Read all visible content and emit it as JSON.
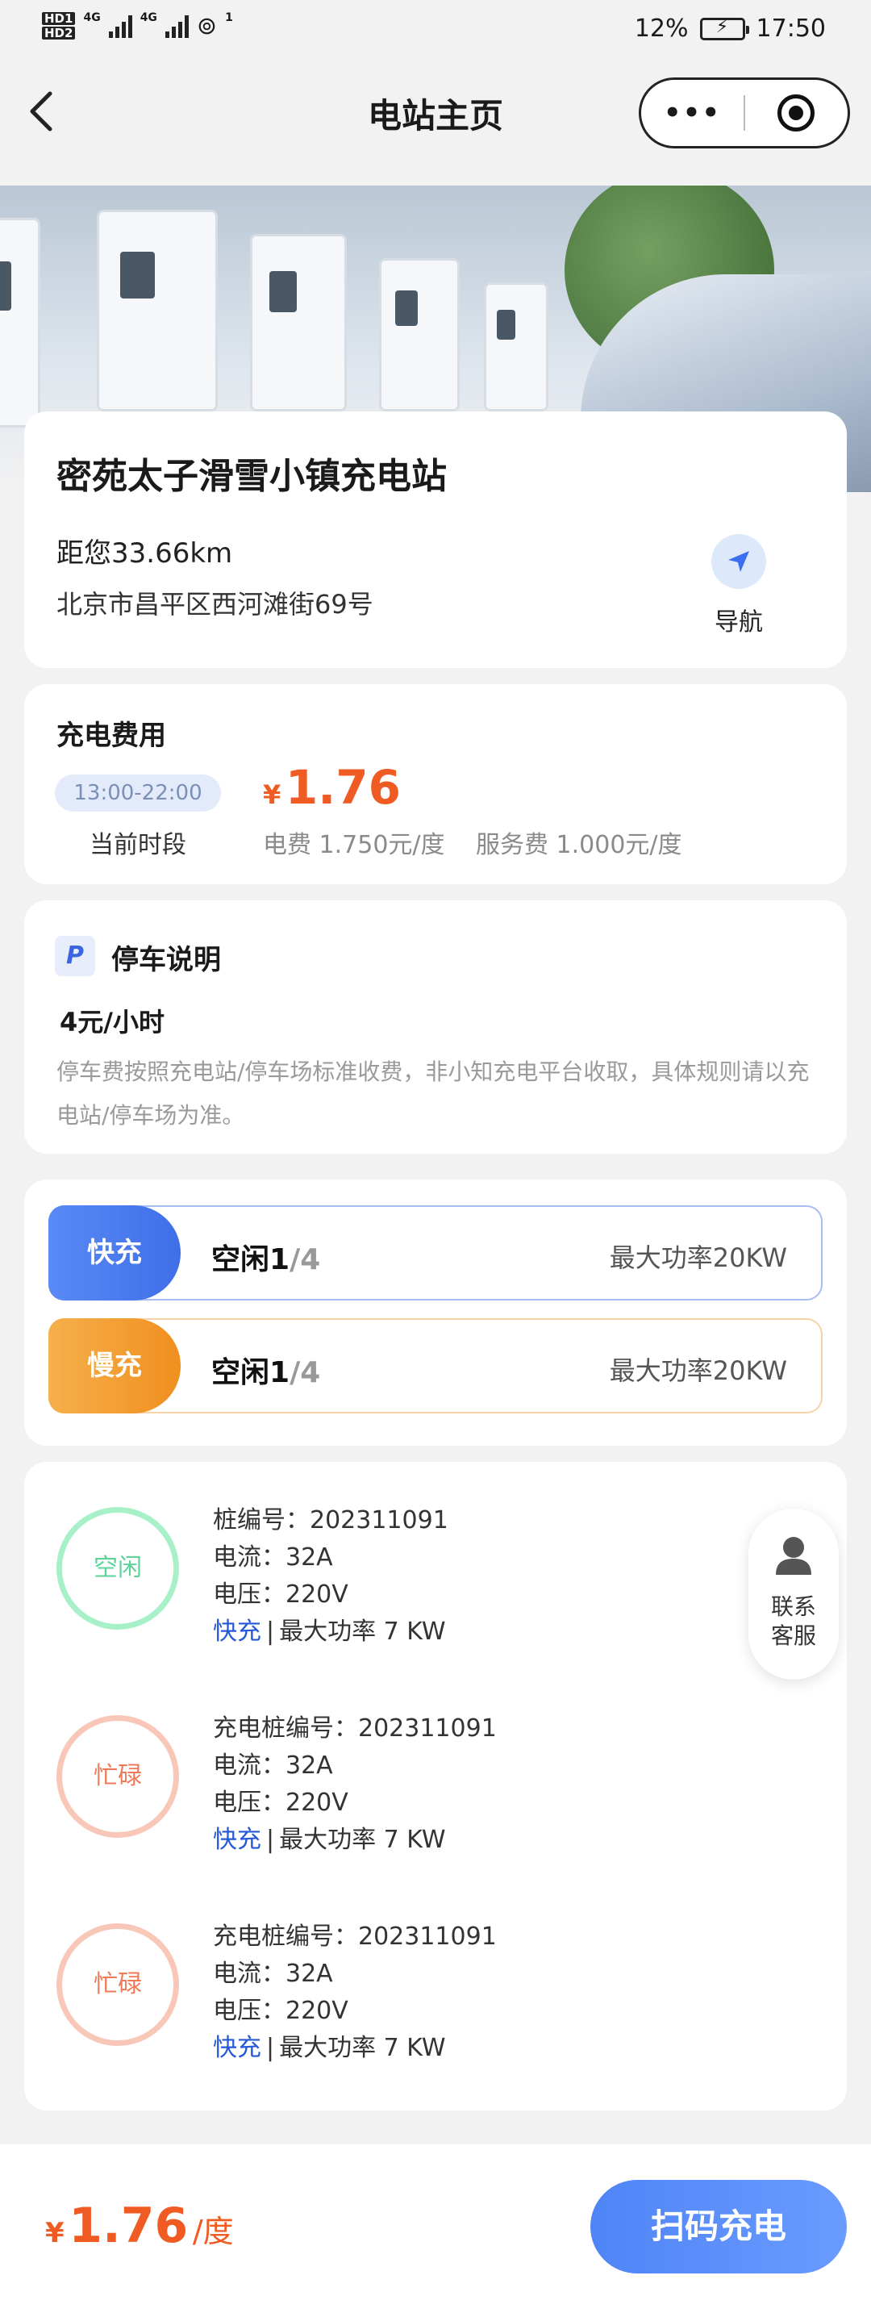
{
  "status_bar": {
    "sim1": "HD1",
    "sim2": "HD2",
    "net1": "4G",
    "net2": "4G",
    "hotspot_sup": "1",
    "battery_pct": "12%",
    "time": "17:50"
  },
  "header": {
    "title": "电站主页",
    "more_label": "•••"
  },
  "station": {
    "name": "密苑太子滑雪小镇充电站",
    "distance": "距您33.66km",
    "address": "北京市昌平区西河滩街69号",
    "nav_label": "导航"
  },
  "fee": {
    "title": "充电费用",
    "period": "13:00-22:00",
    "period_label": "当前时段",
    "currency": "¥",
    "price": "1.76",
    "electricity": "电费 1.750元/度",
    "service": "服务费 1.000元/度"
  },
  "parking": {
    "badge": "P",
    "title": "停车说明",
    "price": "4元/小时",
    "desc": "停车费按照充电站/停车场标准收费，非小知充电平台收取，具体规则请以充电站/停车场为准。"
  },
  "ports": [
    {
      "tag": "快充",
      "idle_label": "空闲",
      "idle": "1",
      "total": "/4",
      "power": "最大功率20KW"
    },
    {
      "tag": "慢充",
      "idle_label": "空闲",
      "idle": "1",
      "total": "/4",
      "power": "最大功率20KW"
    }
  ],
  "piles": [
    {
      "status": "空闲",
      "id_line": "桩编号：202311091",
      "current": "电流：32A",
      "voltage": "电压：220V",
      "type": "快充",
      "sep": "|",
      "power": "最大功率 7 KW"
    },
    {
      "status": "忙碌",
      "id_line": "充电桩编号：202311091",
      "current": "电流：32A",
      "voltage": "电压：220V",
      "type": "快充",
      "sep": "|",
      "power": "最大功率 7 KW"
    },
    {
      "status": "忙碌",
      "id_line": "充电桩编号：202311091",
      "current": "电流：32A",
      "voltage": "电压：220V",
      "type": "快充",
      "sep": "|",
      "power": "最大功率 7 KW"
    }
  ],
  "service": {
    "line1": "联系",
    "line2": "客服"
  },
  "bottom": {
    "currency": "¥",
    "price": "1.76",
    "unit": "/度",
    "button": "扫码充电"
  },
  "colors": {
    "accent_blue": "#4f84f6",
    "price_orange": "#f05a23",
    "idle_green": "#5dd39a",
    "busy_red": "#ef7a58"
  }
}
